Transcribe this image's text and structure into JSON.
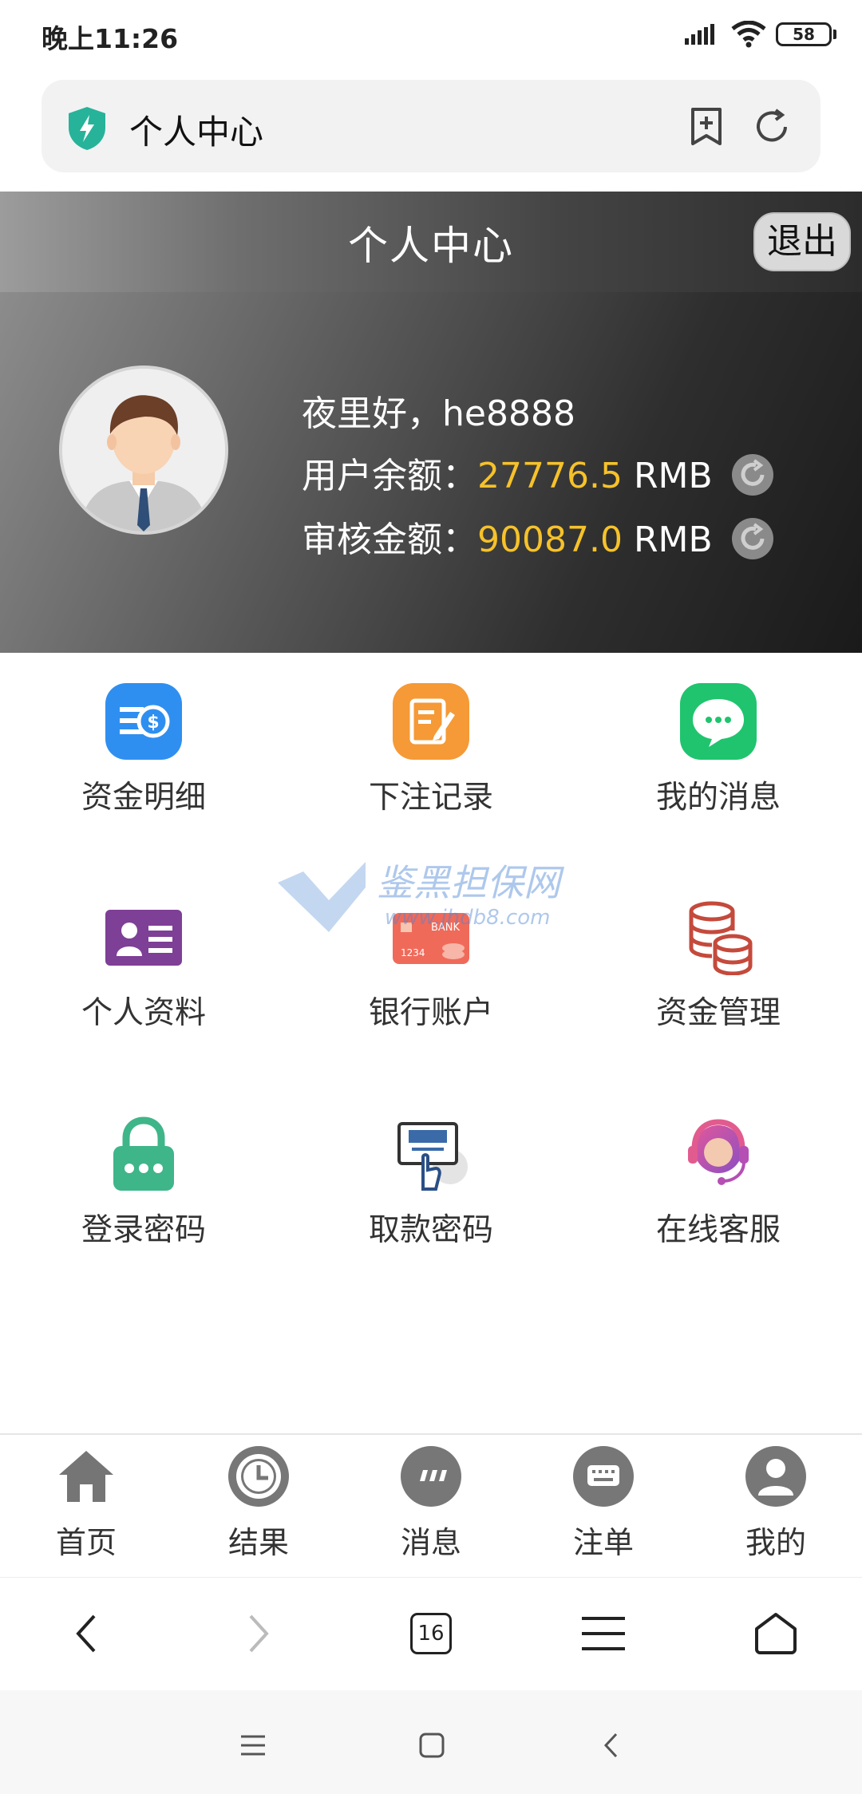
{
  "status_bar": {
    "time": "晚上11:26",
    "battery": "58"
  },
  "address_bar": {
    "title": "个人中心",
    "icons": [
      "shield-icon",
      "bookmark-add-icon",
      "refresh-icon"
    ]
  },
  "header": {
    "title": "个人中心",
    "logout_label": "退出"
  },
  "profile": {
    "greeting": "夜里好，he8888",
    "balance_label": "用户余额：",
    "balance_value": "27776.5",
    "balance_unit": "RMB",
    "review_label": "审核金额：",
    "review_value": "90087.0",
    "review_unit": "RMB",
    "accent_color": "#f6c22a"
  },
  "menu": [
    {
      "label": "资金明细",
      "icon": "money-detail-icon"
    },
    {
      "label": "下注记录",
      "icon": "bet-record-icon"
    },
    {
      "label": "我的消息",
      "icon": "message-icon"
    },
    {
      "label": "个人资料",
      "icon": "profile-card-icon"
    },
    {
      "label": "银行账户",
      "icon": "bank-card-icon"
    },
    {
      "label": "资金管理",
      "icon": "coin-stack-icon"
    },
    {
      "label": "登录密码",
      "icon": "lock-icon"
    },
    {
      "label": "取款密码",
      "icon": "atm-icon"
    },
    {
      "label": "在线客服",
      "icon": "headset-icon"
    }
  ],
  "watermark": {
    "title": "鉴黑担保网",
    "url": "www.jhdb8.com",
    "bank_text": "BANK",
    "card_number": "1234"
  },
  "tabbar": [
    {
      "label": "首页",
      "icon": "home-icon"
    },
    {
      "label": "结果",
      "icon": "clock-icon"
    },
    {
      "label": "消息",
      "icon": "chat-icon"
    },
    {
      "label": "注单",
      "icon": "bet-slip-icon"
    },
    {
      "label": "我的",
      "icon": "user-icon"
    }
  ],
  "browser_toolbar": {
    "tab_count": "16"
  }
}
